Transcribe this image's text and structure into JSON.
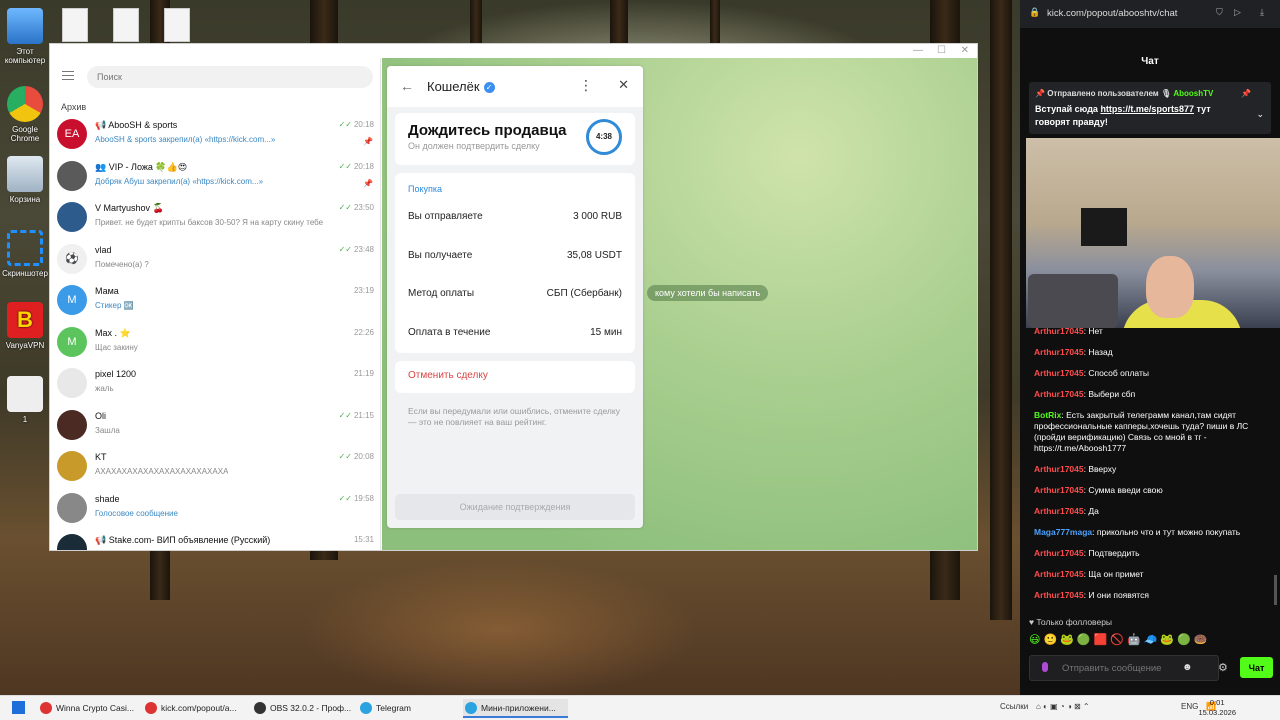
{
  "desktop": {
    "icons": [
      "Этот компьютер",
      "Google Chrome",
      "Корзина",
      "Скриншотер",
      "VanyaVPN",
      "1"
    ]
  },
  "telegram": {
    "search_placeholder": "Поиск",
    "archive": "Архив",
    "chats": [
      {
        "name": "📢 AbooSH & sports",
        "preview": "AbooSH & sports закрепил(а) «https://kick.com...»",
        "time": "20:18",
        "checks": "✓✓",
        "pinned": true,
        "avatar_text": "EA",
        "avatar_color": "#c8102e",
        "blue": true
      },
      {
        "name": "👥 VIP - Ложа 🍀👍😍",
        "preview": "Добряк Абуш закрепил(а) «https://kick.com...»",
        "time": "20:18",
        "checks": "✓✓",
        "pinned": true,
        "avatar_text": "",
        "avatar_color": "#5a5a5a",
        "blue": true
      },
      {
        "name": "V Martyushov 🍒",
        "preview": "Привет. не будет крипты баксов 30-50? Я на карту скину тебе",
        "time": "23:50",
        "checks": "✓✓",
        "pinned": false,
        "avatar_text": "",
        "avatar_color": "#2d5b8c",
        "blue": false
      },
      {
        "name": "vlad",
        "preview": "Помечено(а) ?",
        "time": "23:48",
        "checks": "✓✓",
        "pinned": false,
        "avatar_text": "⚽",
        "avatar_color": "#f0f0f0",
        "blue": false
      },
      {
        "name": "Мама",
        "preview": "Стикер 🆗",
        "time": "23:19",
        "checks": "",
        "pinned": false,
        "avatar_text": "М",
        "avatar_color": "#3c9be8",
        "blue": true
      },
      {
        "name": "Max . ⭐",
        "preview": "Щас закину",
        "time": "22:26",
        "checks": "",
        "pinned": false,
        "avatar_text": "M",
        "avatar_color": "#5cc45c",
        "blue": false
      },
      {
        "name": "pixel 1200",
        "preview": "жаль",
        "time": "21:19",
        "checks": "",
        "pinned": false,
        "avatar_text": "",
        "avatar_color": "#e8e8e8",
        "blue": false
      },
      {
        "name": "Oli",
        "preview": "Зашла",
        "time": "21:15",
        "checks": "✓✓",
        "pinned": false,
        "avatar_text": "",
        "avatar_color": "#4a2a22",
        "blue": false
      },
      {
        "name": "KT",
        "preview": "АХАХАХАХАХАХАХАХАХАХАХАХА",
        "time": "20:08",
        "checks": "✓✓",
        "pinned": false,
        "avatar_text": "",
        "avatar_color": "#c89a2a",
        "blue": false
      },
      {
        "name": "shade",
        "preview": "Голосовое сообщение",
        "time": "19:58",
        "checks": "✓✓",
        "pinned": false,
        "avatar_text": "",
        "avatar_color": "#888888",
        "blue": true
      },
      {
        "name": "📢 Stake.com- ВИП объявление (Русский)",
        "preview": "",
        "time": "15:31",
        "checks": "",
        "pinned": false,
        "avatar_text": "",
        "avatar_color": "#1a2c38",
        "blue": false
      }
    ],
    "chat_hint": "кому хотели бы написать"
  },
  "wallet": {
    "title": "Кошелёк",
    "wait_title": "Дождитесь продавца",
    "wait_sub": "Он должен подтвердить сделку",
    "timer": "4:38",
    "section": "Покупка",
    "rows": [
      {
        "label": "Вы отправляете",
        "value": "3 000 RUB"
      },
      {
        "label": "Вы получаете",
        "value": "35,08 USDT"
      },
      {
        "label": "Метод оплаты",
        "value": "СБП (Сбербанк)"
      },
      {
        "label": "Оплата в течение",
        "value": "15 мин"
      }
    ],
    "cancel": "Отменить сделку",
    "note": "Если вы передумали или ошиблись, отмените сделку — это не повлияет на ваш рейтинг.",
    "confirm": "Ожидание подтверждения"
  },
  "kick": {
    "url": "kick.com/popout/abooshtv/chat",
    "title": "Чат",
    "pinned_by": "Отправлено пользователем",
    "pinned_user": "AbooshTV",
    "pinned_msg": "Вступай сюда",
    "pinned_link": "https://t.me/sports877",
    "pinned_tail": "тут говорят правду!",
    "messages": [
      {
        "user": "Arthur17045",
        "color": "#ff4b4b",
        "text": "Нет"
      },
      {
        "user": "Arthur17045",
        "color": "#ff4b4b",
        "text": "Назад"
      },
      {
        "user": "Arthur17045",
        "color": "#ff4b4b",
        "text": "Способ оплаты"
      },
      {
        "user": "Arthur17045",
        "color": "#ff4b4b",
        "text": "Выбери сбп"
      },
      {
        "user": "BotRix",
        "color": "#53fc18",
        "text": "Есть закрытый телеграмм канал,там сидят профессиональные капперы,хочешь туда? пиши в ЛС (пройди верификацию) Связь со мной в тг - https://t.me/Aboosh1777"
      },
      {
        "user": "Arthur17045",
        "color": "#ff4b4b",
        "text": "Вверху"
      },
      {
        "user": "Arthur17045",
        "color": "#ff4b4b",
        "text": "Сумма введи свою"
      },
      {
        "user": "Arthur17045",
        "color": "#ff4b4b",
        "text": "Да"
      },
      {
        "user": "Maga777maga",
        "color": "#4aa3ff",
        "text": "прикольно что и тут можно покупать"
      },
      {
        "user": "Arthur17045",
        "color": "#ff4b4b",
        "text": "Подтвердить"
      },
      {
        "user": "Arthur17045",
        "color": "#ff4b4b",
        "text": "Ща он примет"
      },
      {
        "user": "Arthur17045",
        "color": "#ff4b4b",
        "text": "И они появятся"
      }
    ],
    "followers": "♥ Только фолловеры",
    "emotes": "😃🙂🐸🟢🟥🚫🤖🧢🐸🟢🍩",
    "input_placeholder": "Отправить сообщение",
    "send": "Чат"
  },
  "taskbar": {
    "items": [
      {
        "label": "Winna Crypto Casi...",
        "color": "#d33"
      },
      {
        "label": "kick.com/popout/a...",
        "color": "#d33"
      },
      {
        "label": "OBS 32.0.2 - Проф...",
        "color": "#333"
      },
      {
        "label": "Telegram",
        "color": "#2aa3e0"
      },
      {
        "label": "Мини-приложени...",
        "color": "#2aa3e0"
      }
    ],
    "links": "Ссылки",
    "lang": "ENG",
    "time": "0:01",
    "date": "15.03.2026"
  }
}
